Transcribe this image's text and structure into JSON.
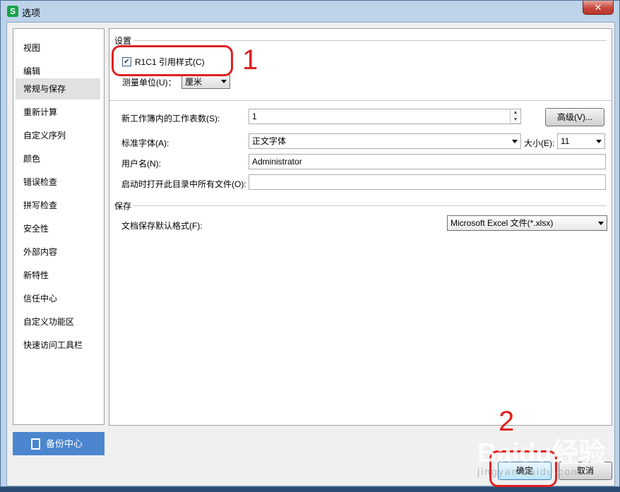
{
  "window": {
    "title": "选项",
    "app_icon": "S",
    "close_glyph": "✕"
  },
  "sidebar": {
    "items": [
      "视图",
      "编辑",
      "常规与保存",
      "重新计算",
      "自定义序列",
      "颜色",
      "错误检查",
      "拼写检查",
      "安全性",
      "外部内容",
      "新特性",
      "信任中心",
      "自定义功能区",
      "快速访问工具栏"
    ],
    "selected_index": 2,
    "backup_label": "备份中心"
  },
  "settings": {
    "group_label": "设置",
    "r1c1_label": "R1C1 引用样式(C)",
    "r1c1_checked": true,
    "unit_label": "测量单位(U)：",
    "unit_value": "厘米",
    "sheets_label": "新工作簿内的工作表数(S):",
    "sheets_value": "1",
    "advanced_button": "高级(V)...",
    "font_label": "标准字体(A):",
    "font_value": "正文字体",
    "size_label": "大小(E):",
    "size_value": "11",
    "username_label": "用户名(N):",
    "username_value": "Administrator",
    "startup_label": "启动时打开此目录中所有文件(O):",
    "startup_value": ""
  },
  "save": {
    "group_label": "保存",
    "format_label": "文档保存默认格式(F):",
    "format_value": "Microsoft Excel 文件(*.xlsx)"
  },
  "footer": {
    "ok_label": "确定",
    "cancel_label": "取消"
  },
  "annotations": {
    "step1": "1",
    "step2": "2",
    "color": "#e02020"
  },
  "watermark": {
    "logo": "Baidu经验",
    "url": "jingyan.baidu.com"
  }
}
